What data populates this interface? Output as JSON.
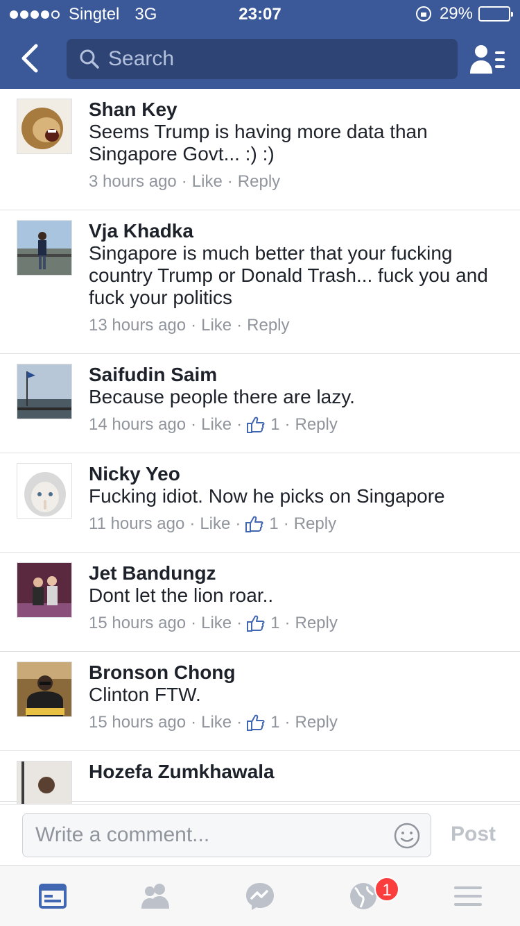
{
  "status_bar": {
    "carrier": "Singtel",
    "network": "3G",
    "time": "23:07",
    "battery": "29%",
    "signal_bars_filled": 4,
    "signal_bars_total": 5,
    "battery_level": 0.29,
    "battery_color": "#f5c518"
  },
  "header": {
    "back_icon": "chevron-left-icon",
    "search_placeholder": "Search",
    "friends_icon": "friend-requests-icon",
    "color": "#3b5998"
  },
  "comments": [
    {
      "name": "Shan Key",
      "text": "Seems Trump is having more data than Singapore Govt... :) :)",
      "time": "3 hours ago",
      "like": "Like",
      "reply": "Reply",
      "like_count": ""
    },
    {
      "name": "Vja Khadka",
      "text": "Singapore is much better that your fucking country Trump or Donald Trash... fuck you and fuck your politics",
      "time": "13 hours ago",
      "like": "Like",
      "reply": "Reply",
      "like_count": ""
    },
    {
      "name": "Saifudin Saim",
      "text": "Because people there are lazy.",
      "time": "14 hours ago",
      "like": "Like",
      "reply": "Reply",
      "like_count": "1"
    },
    {
      "name": "Nicky Yeo",
      "text": "Fucking idiot. Now he picks on Singapore",
      "time": "11 hours ago",
      "like": "Like",
      "reply": "Reply",
      "like_count": "1"
    },
    {
      "name": "Jet Bandungz",
      "text": "Dont let the lion roar..",
      "time": "15 hours ago",
      "like": "Like",
      "reply": "Reply",
      "like_count": "1"
    },
    {
      "name": "Bronson Chong",
      "text": "Clinton FTW.",
      "time": "15 hours ago",
      "like": "Like",
      "reply": "Reply",
      "like_count": "1"
    },
    {
      "name": "Hozefa Zumkhawala",
      "text": "",
      "time": "",
      "like": "",
      "reply": "",
      "like_count": ""
    }
  ],
  "composer": {
    "placeholder": "Write a comment...",
    "post_label": "Post"
  },
  "tabbar": {
    "items": [
      "news-feed-icon",
      "friends-icon",
      "messenger-icon",
      "notifications-globe-icon",
      "menu-icon"
    ],
    "notification_badge": "1",
    "active_color": "#4267b2"
  }
}
